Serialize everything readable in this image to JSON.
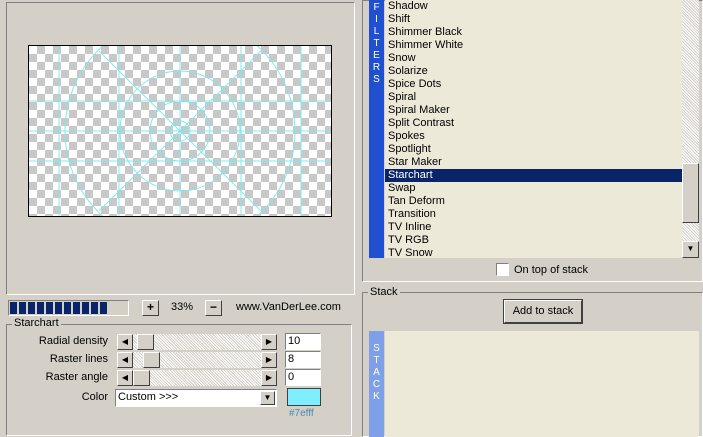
{
  "filters": {
    "tab_label": "FILTERS",
    "items": [
      "Shadow",
      "Shift",
      "Shimmer Black",
      "Shimmer White",
      "Snow",
      "Solarize",
      "Spice Dots",
      "Spiral",
      "Spiral Maker",
      "Split Contrast",
      "Spokes",
      "Spotlight",
      "Star Maker",
      "Starchart",
      "Swap",
      "Tan Deform",
      "Transition",
      "TV Inline",
      "TV RGB",
      "TV Snow"
    ],
    "selected": "Starchart",
    "top_of_stack_label": "On top of stack"
  },
  "toolbar": {
    "progress_segments": 11,
    "zoom_plus": "+",
    "zoom_value": "33%",
    "zoom_minus": "−",
    "site": "www.VanDerLee.com"
  },
  "starchart": {
    "group_title": "Starchart",
    "params": [
      {
        "label": "Radial density",
        "value": "10",
        "fraction": 0.04
      },
      {
        "label": "Raster lines",
        "value": "8",
        "fraction": 0.09
      },
      {
        "label": "Raster angle",
        "value": "0",
        "fraction": 0.0
      }
    ],
    "color_label": "Color",
    "color_option": "Custom >>>",
    "color_hex": "#7efff",
    "swatch_color": "#7fefff"
  },
  "stack": {
    "group_title": "Stack",
    "add_button": "Add to stack",
    "tab_label": "STACK"
  },
  "colors": {
    "accent": "#2050d0",
    "selection": "#0a246a",
    "preview_lines": "#7fe8f0"
  }
}
